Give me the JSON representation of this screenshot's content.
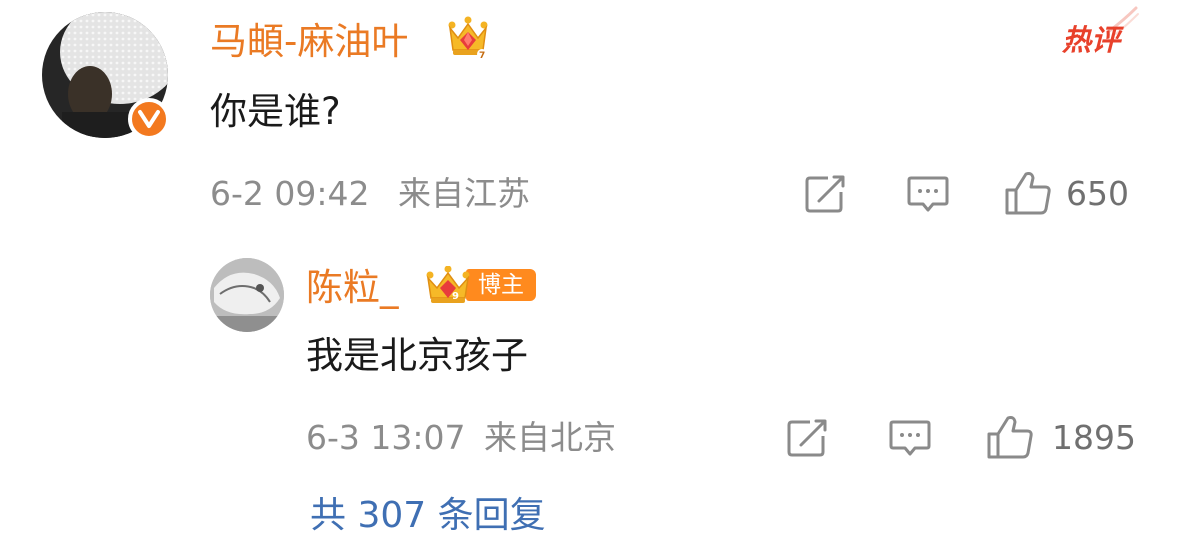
{
  "comment": {
    "username": "马頔-麻油叶",
    "text": "你是谁?",
    "time": "6-2 09:42",
    "location": "来自江苏",
    "likes": "650",
    "hot_label": "热评"
  },
  "reply": {
    "username": "陈粒_",
    "badge_label": "博主",
    "text": "我是北京孩子",
    "time": "6-3 13:07",
    "location": "来自北京",
    "likes": "1895"
  },
  "more_replies": "共 307 条回复",
  "colors": {
    "username": "#ea7a24",
    "hot_label": "#e8412b",
    "verified_badge": "#f3791f",
    "blogger_badge": "#ff8a1e",
    "icon_gray": "#8a8a8a",
    "meta_gray": "#8c8c8c",
    "link_blue": "#3f6fb3"
  },
  "icons": {
    "crown": "crown-icon",
    "verified": "verified-v-icon",
    "repost": "repost-icon",
    "comment": "comment-icon",
    "like": "thumbs-up-icon"
  }
}
